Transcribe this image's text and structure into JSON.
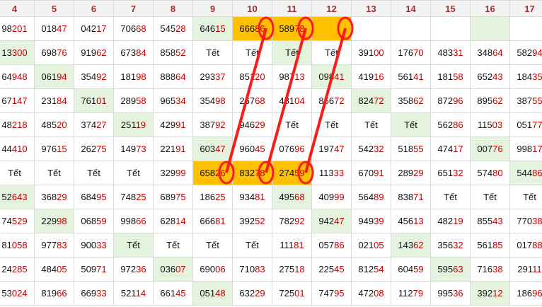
{
  "columns": [
    "4",
    "5",
    "6",
    "7",
    "8",
    "9",
    "10",
    "11",
    "12",
    "13",
    "14",
    "15",
    "16",
    "17"
  ],
  "tet_label": "Tết",
  "rows": [
    [
      {
        "h": "98",
        "t": "201"
      },
      {
        "h": "018",
        "t": "47"
      },
      {
        "h": "042",
        "t": "17"
      },
      {
        "h": "706",
        "t": "68"
      },
      {
        "h": "545",
        "t": "28"
      },
      {
        "h": "646",
        "t": "15",
        "bg": "g"
      },
      {
        "h": "666",
        "t": "86",
        "bg": "o"
      },
      {
        "h": "589",
        "t": "78",
        "bg": "o"
      },
      {
        "h": "",
        "t": "",
        "bg": "o"
      },
      {
        "h": "",
        "t": ""
      },
      {
        "h": "",
        "t": ""
      },
      {
        "h": "",
        "t": ""
      },
      {
        "h": "",
        "t": "",
        "bg": "g"
      },
      {
        "h": "",
        "t": ""
      }
    ],
    [
      {
        "h": "13",
        "t": "300",
        "bg": "g"
      },
      {
        "h": "698",
        "t": "76"
      },
      {
        "h": "919",
        "t": "62"
      },
      {
        "h": "673",
        "t": "84"
      },
      {
        "h": "858",
        "t": "52"
      },
      {
        "tet": true
      },
      {
        "tet": true
      },
      {
        "tet": true,
        "bg": "g"
      },
      {
        "tet": true
      },
      {
        "h": "391",
        "t": "00"
      },
      {
        "h": "176",
        "t": "70"
      },
      {
        "h": "483",
        "t": "31"
      },
      {
        "h": "348",
        "t": "64"
      },
      {
        "h": "582",
        "t": "94"
      }
    ],
    [
      {
        "h": "64",
        "t": "948"
      },
      {
        "h": "061",
        "t": "94",
        "bg": "g"
      },
      {
        "h": "354",
        "t": "92"
      },
      {
        "h": "181",
        "t": "98"
      },
      {
        "h": "888",
        "t": "64"
      },
      {
        "h": "293",
        "t": "37"
      },
      {
        "h": "851",
        "t": "20"
      },
      {
        "h": "987",
        "t": "13"
      },
      {
        "h": "098",
        "t": "41",
        "bg": "g"
      },
      {
        "h": "419",
        "t": "16"
      },
      {
        "h": "561",
        "t": "41"
      },
      {
        "h": "181",
        "t": "58"
      },
      {
        "h": "652",
        "t": "43"
      },
      {
        "h": "184",
        "t": "35"
      }
    ],
    [
      {
        "h": "67",
        "t": "147"
      },
      {
        "h": "231",
        "t": "84"
      },
      {
        "h": "761",
        "t": "01",
        "bg": "g"
      },
      {
        "h": "289",
        "t": "58"
      },
      {
        "h": "965",
        "t": "34"
      },
      {
        "h": "354",
        "t": "98"
      },
      {
        "h": "267",
        "t": "68"
      },
      {
        "h": "481",
        "t": "04"
      },
      {
        "h": "856",
        "t": "72"
      },
      {
        "h": "824",
        "t": "72",
        "bg": "g"
      },
      {
        "h": "358",
        "t": "62"
      },
      {
        "h": "872",
        "t": "96"
      },
      {
        "h": "895",
        "t": "62"
      },
      {
        "h": "387",
        "t": "55"
      }
    ],
    [
      {
        "h": "48",
        "t": "218"
      },
      {
        "h": "485",
        "t": "20"
      },
      {
        "h": "374",
        "t": "27"
      },
      {
        "h": "251",
        "t": "19",
        "bg": "g"
      },
      {
        "h": "429",
        "t": "91"
      },
      {
        "h": "387",
        "t": "92"
      },
      {
        "h": "946",
        "t": "29"
      },
      {
        "tet": true
      },
      {
        "tet": true
      },
      {
        "tet": true
      },
      {
        "tet": true,
        "bg": "g"
      },
      {
        "h": "562",
        "t": "86"
      },
      {
        "h": "115",
        "t": "03"
      },
      {
        "h": "051",
        "t": "77"
      }
    ],
    [
      {
        "h": "44",
        "t": "410"
      },
      {
        "h": "976",
        "t": "15"
      },
      {
        "h": "262",
        "t": "75"
      },
      {
        "h": "149",
        "t": "73"
      },
      {
        "h": "221",
        "t": "91"
      },
      {
        "h": "603",
        "t": "47",
        "bg": "g"
      },
      {
        "h": "960",
        "t": "45"
      },
      {
        "h": "076",
        "t": "96"
      },
      {
        "h": "197",
        "t": "47"
      },
      {
        "h": "542",
        "t": "32"
      },
      {
        "h": "518",
        "t": "55"
      },
      {
        "h": "474",
        "t": "17"
      },
      {
        "h": "007",
        "t": "76",
        "bg": "g"
      },
      {
        "h": "998",
        "t": "17"
      }
    ],
    [
      {
        "tet": true
      },
      {
        "tet": true
      },
      {
        "tet": true
      },
      {
        "tet": true
      },
      {
        "h": "329",
        "t": "99"
      },
      {
        "h": "658",
        "t": "26",
        "bg": "o"
      },
      {
        "h": "832",
        "t": "78",
        "bg": "o"
      },
      {
        "h": "274",
        "t": "59",
        "bg": "o"
      },
      {
        "h": "113",
        "t": "33"
      },
      {
        "h": "670",
        "t": "91"
      },
      {
        "h": "289",
        "t": "29"
      },
      {
        "h": "651",
        "t": "32"
      },
      {
        "h": "574",
        "t": "80"
      },
      {
        "h": "544",
        "t": "86",
        "bg": "g"
      }
    ],
    [
      {
        "h": "52",
        "t": "643",
        "bg": "g"
      },
      {
        "h": "368",
        "t": "29"
      },
      {
        "h": "684",
        "t": "95"
      },
      {
        "h": "748",
        "t": "25"
      },
      {
        "h": "689",
        "t": "75"
      },
      {
        "h": "186",
        "t": "25"
      },
      {
        "h": "934",
        "t": "81"
      },
      {
        "h": "495",
        "t": "68",
        "bg": "g"
      },
      {
        "h": "409",
        "t": "99"
      },
      {
        "h": "564",
        "t": "89"
      },
      {
        "h": "838",
        "t": "71"
      },
      {
        "tet": true
      },
      {
        "tet": true
      },
      {
        "tet": true
      }
    ],
    [
      {
        "h": "74",
        "t": "529"
      },
      {
        "h": "229",
        "t": "98",
        "bg": "g"
      },
      {
        "h": "068",
        "t": "59"
      },
      {
        "h": "998",
        "t": "66"
      },
      {
        "h": "628",
        "t": "14"
      },
      {
        "h": "666",
        "t": "81"
      },
      {
        "h": "392",
        "t": "52"
      },
      {
        "h": "782",
        "t": "92"
      },
      {
        "h": "942",
        "t": "47",
        "bg": "g"
      },
      {
        "h": "949",
        "t": "39"
      },
      {
        "h": "456",
        "t": "13"
      },
      {
        "h": "482",
        "t": "19"
      },
      {
        "h": "855",
        "t": "43"
      },
      {
        "h": "770",
        "t": "38"
      }
    ],
    [
      {
        "h": "81",
        "t": "058"
      },
      {
        "h": "977",
        "t": "83"
      },
      {
        "h": "900",
        "t": "33"
      },
      {
        "tet": true,
        "bg": "g"
      },
      {
        "tet": true
      },
      {
        "tet": true
      },
      {
        "tet": true
      },
      {
        "h": "111",
        "t": "81"
      },
      {
        "h": "057",
        "t": "86"
      },
      {
        "h": "021",
        "t": "05"
      },
      {
        "h": "143",
        "t": "62",
        "bg": "g"
      },
      {
        "h": "356",
        "t": "32"
      },
      {
        "h": "561",
        "t": "85"
      },
      {
        "h": "017",
        "t": "88"
      }
    ],
    [
      {
        "h": "24",
        "t": "285"
      },
      {
        "h": "484",
        "t": "05"
      },
      {
        "h": "509",
        "t": "71"
      },
      {
        "h": "972",
        "t": "36"
      },
      {
        "h": "036",
        "t": "07",
        "bg": "g"
      },
      {
        "h": "690",
        "t": "06"
      },
      {
        "h": "710",
        "t": "83"
      },
      {
        "h": "275",
        "t": "18"
      },
      {
        "h": "225",
        "t": "45"
      },
      {
        "h": "812",
        "t": "54"
      },
      {
        "h": "604",
        "t": "59"
      },
      {
        "h": "595",
        "t": "63",
        "bg": "g"
      },
      {
        "h": "716",
        "t": "38"
      },
      {
        "h": "291",
        "t": "11"
      }
    ],
    [
      {
        "h": "53",
        "t": "024"
      },
      {
        "h": "819",
        "t": "66"
      },
      {
        "h": "669",
        "t": "33"
      },
      {
        "h": "521",
        "t": "14"
      },
      {
        "h": "661",
        "t": "45"
      },
      {
        "h": "051",
        "t": "48",
        "bg": "g"
      },
      {
        "h": "632",
        "t": "29"
      },
      {
        "h": "725",
        "t": "01"
      },
      {
        "h": "747",
        "t": "95"
      },
      {
        "h": "472",
        "t": "08"
      },
      {
        "h": "112",
        "t": "79"
      },
      {
        "h": "995",
        "t": "36"
      },
      {
        "h": "392",
        "t": "12",
        "bg": "g"
      },
      {
        "h": "186",
        "t": "96"
      }
    ]
  ],
  "annotation": {
    "color": "#ff1a1a",
    "circles": [
      [
        0,
        6
      ],
      [
        0,
        7
      ],
      [
        0,
        8
      ],
      [
        6,
        5
      ],
      [
        6,
        6
      ],
      [
        6,
        7
      ]
    ],
    "lines": [
      [
        [
          0,
          6
        ],
        [
          6,
          5
        ]
      ],
      [
        [
          0,
          7
        ],
        [
          6,
          6
        ]
      ],
      [
        [
          0,
          8
        ],
        [
          6,
          7
        ]
      ]
    ]
  }
}
